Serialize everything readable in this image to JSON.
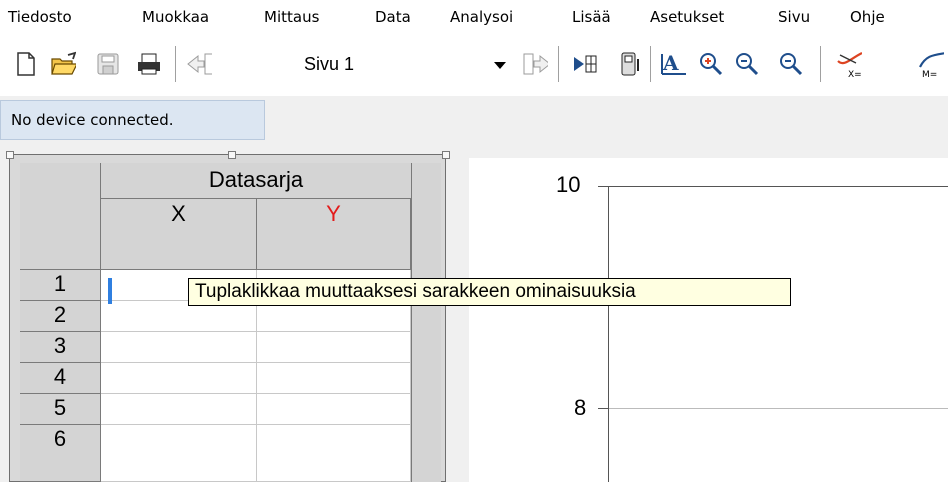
{
  "menu": [
    "Tiedosto",
    "Muokkaa",
    "Mittaus",
    "Data",
    "Analysoi",
    "Lisää",
    "Asetukset",
    "Sivu",
    "Ohje"
  ],
  "toolbar": {
    "page_select": "Sivu 1",
    "icons": [
      "new-file-icon",
      "open-folder-icon",
      "save-icon",
      "print-icon",
      "previous-page-icon",
      "next-page-icon",
      "play-forward-icon",
      "device-icon",
      "autoscale-icon",
      "zoom-in-icon",
      "zoom-out-icon",
      "tangent-icon",
      "model-icon"
    ],
    "labels": {
      "tangent": "X=",
      "model": "M="
    }
  },
  "status": {
    "text": "No device connected."
  },
  "table": {
    "dataset_title": "Datasarja",
    "columns": [
      {
        "label": "X",
        "color": "#000000"
      },
      {
        "label": "Y",
        "color": "#e31b1b"
      }
    ],
    "rows": [
      "1",
      "2",
      "3",
      "4",
      "5",
      "6"
    ]
  },
  "tooltip": {
    "text": "Tuplaklikkaa muuttaaksesi sarakkeen ominaisuuksia"
  },
  "graph": {
    "y_ticks": [
      "10",
      "8"
    ]
  }
}
